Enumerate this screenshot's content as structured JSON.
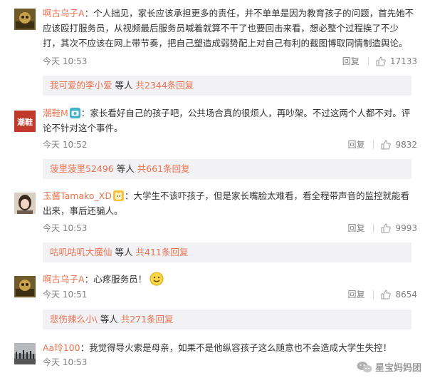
{
  "comments": [
    {
      "username": "啊古乌子A",
      "text": "个人拙见，家长应该承担更多的责任，并不单单是因为教育孩子的问题，首先她不应该殴打服务员，从视频最后服务员喊着就算不干了也要回击来看，想必整个过程挨了不少打，其次不应该在网上带节奏，把自己塑造成弱势配上对自己有利的截图博取同情制造舆论。",
      "time": "今天 10:53",
      "reply_label": "回复",
      "likes": "17133",
      "replies": {
        "user": "我可爱的李小爱",
        "mid": "等人",
        "count": "共2344条回复"
      }
    },
    {
      "username": "潮鞋M",
      "text": "家长看好自己的孩子吧，公共场合真的很烦人，再吵架。不过这两个人都不对。评论不针对这个事件。",
      "time": "今天 10:52",
      "reply_label": "回复",
      "likes": "9832",
      "avatar_text": "潮鞋",
      "replies": {
        "user": "菠里菠里52496",
        "mid": "等人",
        "count": "共661条回复"
      }
    },
    {
      "username": "玉酱Tamako_XD",
      "text": "大学生不该吓孩子，但是家长嘴脸太难看，看全程带声音的监控就能看出来，事后还骗人。",
      "time": "今天 10:53",
      "reply_label": "回复",
      "likes": "9993",
      "replies": {
        "user": "咕叽咕叽大魔仙",
        "mid": "等人",
        "count": "共411条回复"
      }
    },
    {
      "username": "啊古乌子A",
      "text": "心疼服务员！",
      "time": "今天 10:51",
      "reply_label": "回复",
      "likes": "8654",
      "replies": {
        "user": "悲伤辣么小\\",
        "mid": "等人",
        "count": "共271条回复"
      }
    },
    {
      "username": "Aa玲100",
      "text": "我觉得导火索是母亲，如果不是他纵容孩子这么随意也不会造成大学生失控！",
      "time": "今天 10:53"
    }
  ],
  "watermark": "星宝妈妈团",
  "colors": {
    "link": "#eb7350",
    "meta": "#808080",
    "reply_bg": "#f2f2f5"
  },
  "icons": [
    "thumbs-up-icon",
    "camera-badge-icon",
    "cat-badge-icon",
    "smile-emoji-icon",
    "wechat-logo-icon"
  ]
}
